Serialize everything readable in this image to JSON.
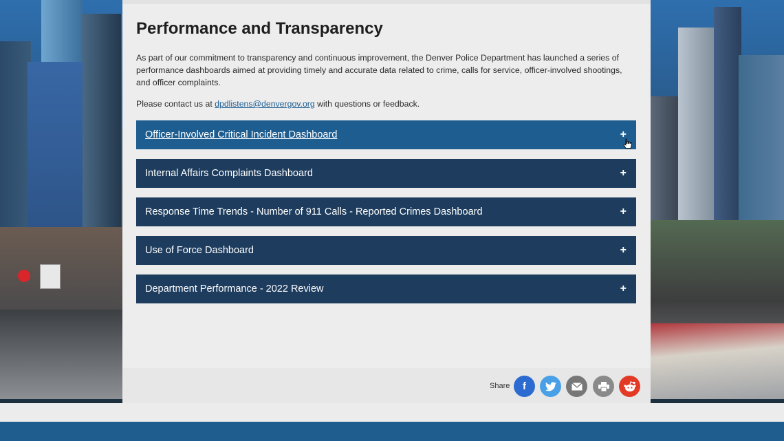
{
  "page": {
    "title": "Performance and Transparency",
    "intro": "As part of our commitment to transparency and continuous improvement, the Denver Police Department has launched a series of performance dashboards aimed at providing timely and accurate data related to crime, calls for service, officer-involved shootings, and officer complaints.",
    "contact_prefix": "Please contact us at ",
    "contact_email": "dpdlistens@denvergov.org",
    "contact_suffix": " with questions or feedback."
  },
  "accordions": [
    {
      "label": "Officer-Involved Critical Incident Dashboard",
      "icon": "+"
    },
    {
      "label": "Internal Affairs Complaints Dashboard",
      "icon": "+"
    },
    {
      "label": "Response Time Trends - Number of 911 Calls - Reported Crimes Dashboard",
      "icon": "+"
    },
    {
      "label": "Use of Force Dashboard",
      "icon": "+"
    },
    {
      "label": "Department Performance - 2022 Review",
      "icon": "+"
    }
  ],
  "share": {
    "label": "Share",
    "buttons": [
      {
        "name": "facebook-icon",
        "glyph": "f",
        "color": "#2d6bd0"
      },
      {
        "name": "twitter-icon",
        "glyph": "",
        "color": "#4aa0e6"
      },
      {
        "name": "email-icon",
        "glyph": "",
        "color": "#777777"
      },
      {
        "name": "print-icon",
        "glyph": "",
        "color": "#8a8a8a"
      },
      {
        "name": "reddit-icon",
        "glyph": "",
        "color": "#e23a25"
      }
    ]
  },
  "colors": {
    "accordion": "#1d3c5e",
    "accordion_active": "#1e5d8f",
    "link": "#1d5e93",
    "footer": "#1f5d8e"
  }
}
